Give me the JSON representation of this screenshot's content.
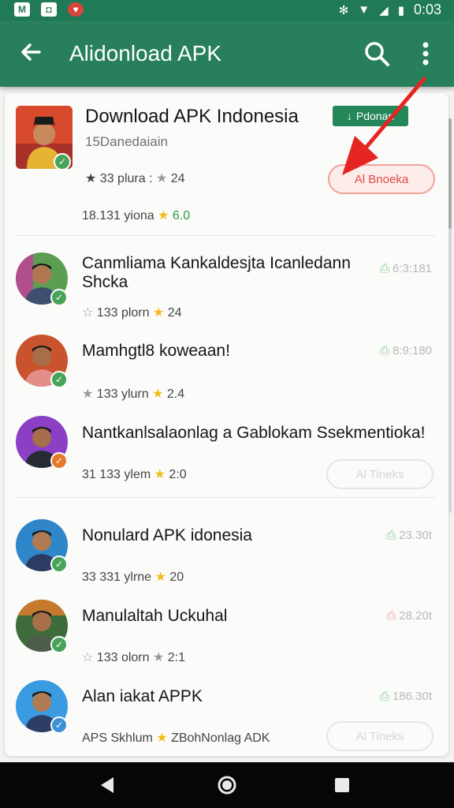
{
  "status_bar": {
    "time": "0:03",
    "icons": [
      "gmail-icon",
      "photo-icon",
      "app-icon",
      "vibrate-icon",
      "wifi-icon",
      "signal-icon",
      "battery-icon"
    ]
  },
  "app_bar": {
    "title": "Alidonload APK",
    "back_icon": "arrow-left-icon",
    "search_icon": "search-icon",
    "more_icon": "more-vert-icon",
    "color": "#27805b"
  },
  "featured": {
    "title": "Download APK Indonesia",
    "subtitle": "15Danedaiain",
    "badge": "Pdonan",
    "badge_prefix": "↓",
    "stat1": "33 plura",
    "stat2": "24",
    "downloads": "18.131 yiona",
    "rating": "6.0",
    "button": "Al Bnoeka"
  },
  "apps": [
    {
      "title_line1": "Canmliama Kankaldesjta Icanledann",
      "title_line2": "Shcka",
      "stat": "133 plorn",
      "rating": "24",
      "right": "6:3:181",
      "badge": "green"
    },
    {
      "title_line1": "Mamhgtl8 koweaan!",
      "title_line2": "",
      "stat": "133 ylurn",
      "rating": "2.4",
      "right": "8:9:180",
      "badge": "green"
    },
    {
      "title_line1": "Nantkanlsalaonlag a Gablokam Ssekmentioka!",
      "title_line2": "",
      "stat": "31 133 ylem",
      "rating": "2:0",
      "right": "",
      "button": "Al Tineks",
      "badge": "orange"
    },
    {
      "title_line1": "Nonulard APK idonesia",
      "title_line2": "",
      "stat": "33 331 ylrne",
      "rating": "20",
      "right": "23.30t",
      "badge": "green"
    },
    {
      "title_line1": "Manulaltah Uckuhal",
      "title_line2": "",
      "stat": "133 olorn",
      "rating": "2:1",
      "right": "28.20t",
      "badge": "green"
    },
    {
      "title_line1": "Alan iakat APPK",
      "title_line2": "",
      "stat": "APS Skhlum",
      "rating": "ZBohNonlag ADK",
      "right": "186.30t",
      "button": "Al Tineks",
      "badge": "blue"
    }
  ],
  "nav": {
    "back": "back-triangle-icon",
    "home": "home-circle-icon",
    "recents": "recents-square-icon"
  }
}
